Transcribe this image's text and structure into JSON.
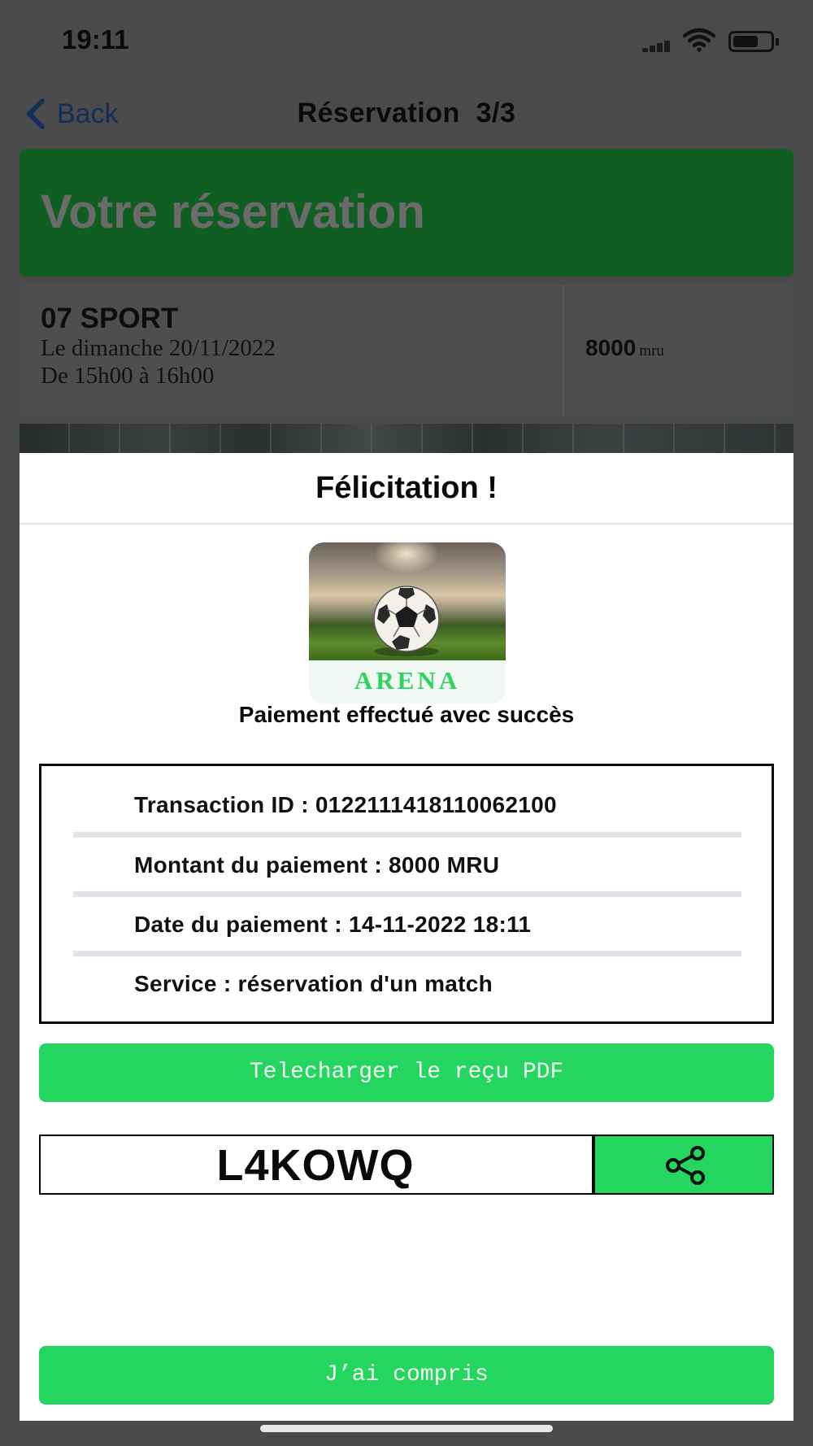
{
  "status_bar": {
    "time": "19:11"
  },
  "nav": {
    "back_label": "Back",
    "title": "Réservation  3/3"
  },
  "hero": {
    "title": "Votre réservation"
  },
  "booking": {
    "venue": "07 SPORT",
    "date": "Le dimanche 20/11/2022",
    "time": "De 15h00 à 16h00",
    "price": "8000",
    "price_unit": "mru"
  },
  "modal": {
    "title": "Félicitation !",
    "logo_text": "ARENA",
    "success_message": "Paiement effectué avec succès",
    "details": [
      "Transaction ID : 0122111418110062100",
      "Montant du paiement : 8000 MRU",
      "Date du paiement : 14-11-2022 18:11",
      "Service : réservation d'un match"
    ],
    "download_label": "Telecharger le reçu PDF",
    "code": "L4KOWQ",
    "confirm_label": "J’ai compris"
  },
  "icons": {
    "back": "chevron-left-icon",
    "share": "share-icon",
    "wifi": "wifi-icon",
    "battery": "battery-icon",
    "signal": "signal-icon",
    "ball": "soccer-ball-icon"
  },
  "colors": {
    "accent_green": "#24d560",
    "banner_green": "#115e22",
    "overlay_gray": "#4a4a4a"
  }
}
